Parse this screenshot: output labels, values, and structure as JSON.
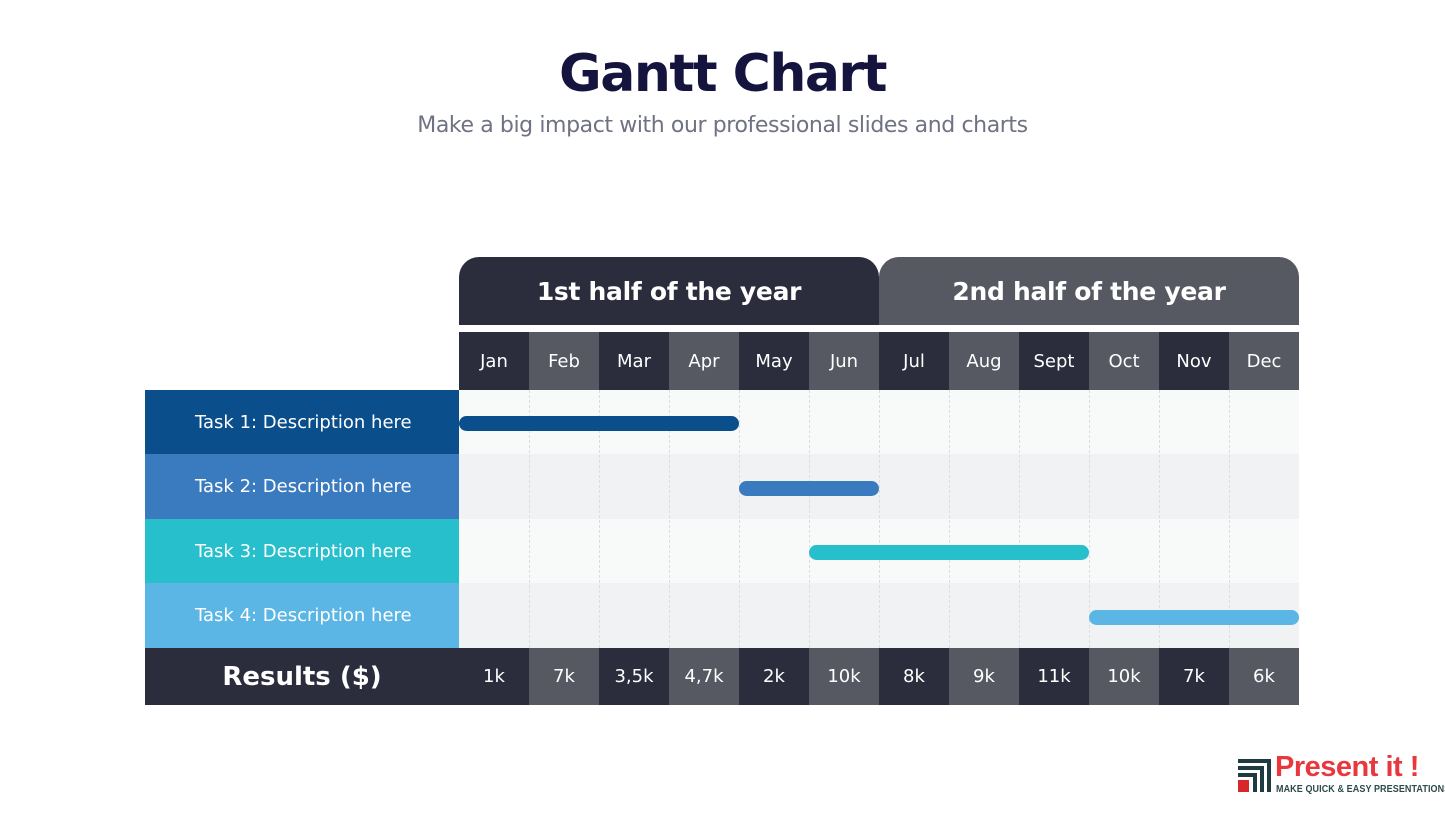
{
  "title": "Gantt Chart",
  "subtitle": "Make a big impact with our professional slides and charts",
  "colors": {
    "dark": "#2b2d3c",
    "mid": "#565862",
    "row_light": "#f8f9f9",
    "row_alt": "#f1f2f4",
    "task1": "#0a4f8b",
    "task2": "#3a7bbf",
    "task3": "#27bfcc",
    "task4": "#5bb6e6"
  },
  "logo": {
    "name": "Present it !",
    "tagline": "MAKE QUICK & EASY PRESENTATIONS"
  },
  "chart_data": {
    "type": "gantt",
    "title": "Gantt Chart",
    "subtitle": "Make a big impact with our professional slides and charts",
    "periods": [
      "1st half of the year",
      "2nd half of the year"
    ],
    "categories": [
      "Jan",
      "Feb",
      "Mar",
      "Apr",
      "May",
      "Jun",
      "Jul",
      "Aug",
      "Sept",
      "Oct",
      "Nov",
      "Dec"
    ],
    "tasks": [
      {
        "label": "Task 1: Description here",
        "start": "Jan",
        "end": "Apr",
        "start_index": 0,
        "end_index": 3,
        "color": "#0a4f8b"
      },
      {
        "label": "Task 2: Description here",
        "start": "May",
        "end": "Jun",
        "start_index": 4,
        "end_index": 5,
        "color": "#3a7bbf"
      },
      {
        "label": "Task 3: Description here",
        "start": "Jun",
        "end": "Sept",
        "start_index": 5,
        "end_index": 8,
        "color": "#27bfcc"
      },
      {
        "label": "Task 4: Description here",
        "start": "Oct",
        "end": "Dec",
        "start_index": 9,
        "end_index": 11,
        "color": "#5bb6e6"
      }
    ],
    "results_label": "Results ($)",
    "results": [
      "1k",
      "7k",
      "3,5k",
      "4,7k",
      "2k",
      "10k",
      "8k",
      "9k",
      "11k",
      "10k",
      "7k",
      "6k"
    ],
    "results_values": [
      1000,
      7000,
      3500,
      4700,
      2000,
      10000,
      8000,
      9000,
      11000,
      10000,
      7000,
      6000
    ],
    "grid": true
  }
}
